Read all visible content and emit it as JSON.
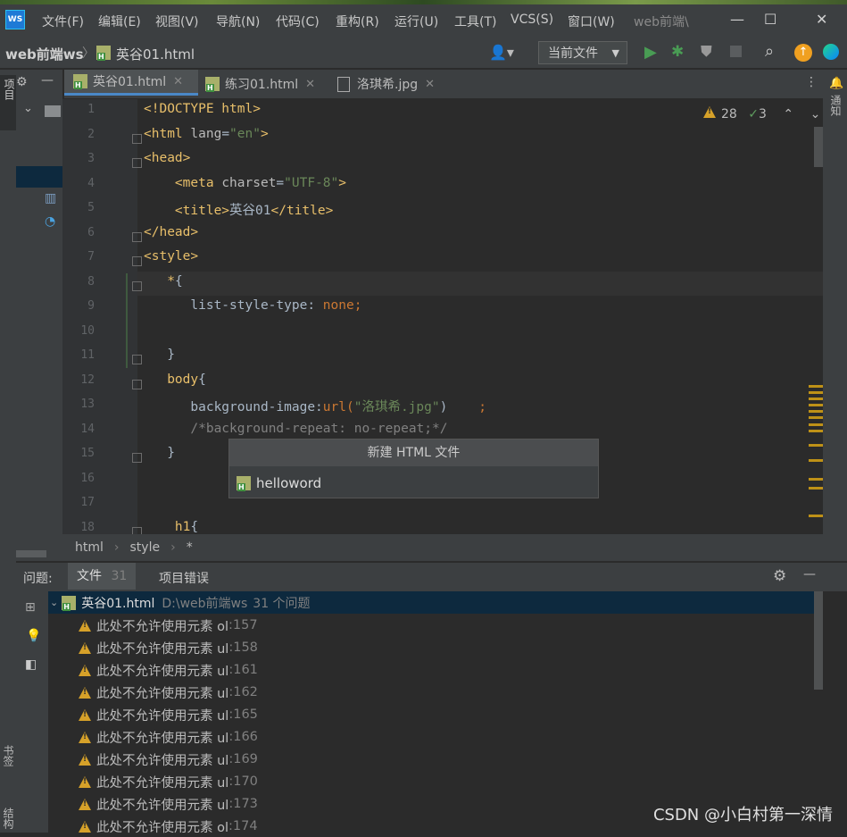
{
  "menu": [
    "文件(F)",
    "编辑(E)",
    "视图(V)",
    "导航(N)",
    "代码(C)",
    "重构(R)",
    "运行(U)",
    "工具(T)",
    "VCS(S)",
    "窗口(W)",
    "web前端\\"
  ],
  "nav": {
    "project": "web前端ws",
    "file": "英谷01.html",
    "run_config": "当前文件"
  },
  "tabs": [
    {
      "label": "英谷01.html"
    },
    {
      "label": "练习01.html"
    },
    {
      "label": "洛琪希.jpg"
    }
  ],
  "inspection": {
    "warnings": "28",
    "checks": "3"
  },
  "code_lines": [
    {
      "n": "1",
      "html": "<span class='tag'>&lt;!DOCTYPE html&gt;</span>"
    },
    {
      "n": "2",
      "html": "<span class='tag'>&lt;html </span><span class='attr'>lang</span>=<span class='str'>\"en\"</span><span class='tag'>&gt;</span>"
    },
    {
      "n": "3",
      "html": "<span class='tag'>&lt;head&gt;</span>"
    },
    {
      "n": "4",
      "html": "    <span class='tag'>&lt;meta </span><span class='attr'>charset</span>=<span class='str'>\"UTF-8\"</span><span class='tag'>&gt;</span>"
    },
    {
      "n": "5",
      "html": "    <span class='tag'>&lt;title&gt;</span>英谷01<span class='tag'>&lt;/title&gt;</span>"
    },
    {
      "n": "6",
      "html": "<span class='tag'>&lt;/head&gt;</span>"
    },
    {
      "n": "7",
      "html": "<span class='tag'>&lt;style&gt;</span>"
    },
    {
      "n": "8",
      "html": "   <span class='tag'>*</span>{"
    },
    {
      "n": "9",
      "html": "      list-style-type: <span class='kw'>none;</span>"
    },
    {
      "n": "10",
      "html": ""
    },
    {
      "n": "11",
      "html": "   }"
    },
    {
      "n": "12",
      "html": "   <span class='tag'>body</span>{"
    },
    {
      "n": "13",
      "html": "      background-image:<span class='kw'>url(</span><span class='str'>\"洛琪希.jpg\"</span>)    <span class='kw'>;</span>"
    },
    {
      "n": "14",
      "html": "      <span class='cmt'>/*background-repeat: no-repeat;*/</span>"
    },
    {
      "n": "15",
      "html": "   }"
    },
    {
      "n": "16",
      "html": ""
    },
    {
      "n": "17",
      "html": ""
    },
    {
      "n": "18",
      "html": "    <span class='tag'>h1</span>{"
    }
  ],
  "popup": {
    "title": "新建 HTML 文件",
    "item": "helloword"
  },
  "breadcrumb": [
    "html",
    "style",
    "*"
  ],
  "problems": {
    "label": "问题:",
    "tab_file": "文件",
    "tab_file_count": "31",
    "tab_project": "项目错误",
    "file": "英谷01.html",
    "path": "D:\\web前端ws",
    "count": "31 个问题",
    "rows": [
      {
        "msg": "此处不允许使用元素 ol",
        "line": ":157"
      },
      {
        "msg": "此处不允许使用元素 ul",
        "line": ":158"
      },
      {
        "msg": "此处不允许使用元素 ul",
        "line": ":161"
      },
      {
        "msg": "此处不允许使用元素 ul",
        "line": ":162"
      },
      {
        "msg": "此处不允许使用元素 ul",
        "line": ":165"
      },
      {
        "msg": "此处不允许使用元素 ul",
        "line": ":166"
      },
      {
        "msg": "此处不允许使用元素 ul",
        "line": ":169"
      },
      {
        "msg": "此处不允许使用元素 ul",
        "line": ":170"
      },
      {
        "msg": "此处不允许使用元素 ul",
        "line": ":173"
      },
      {
        "msg": "此处不允许使用元素 ol",
        "line": ":174"
      }
    ]
  },
  "side_labels": {
    "project": "项目",
    "bookmarks": "书签",
    "structure": "结构",
    "notifications": "通知"
  },
  "watermark": "CSDN @小白村第一深情"
}
